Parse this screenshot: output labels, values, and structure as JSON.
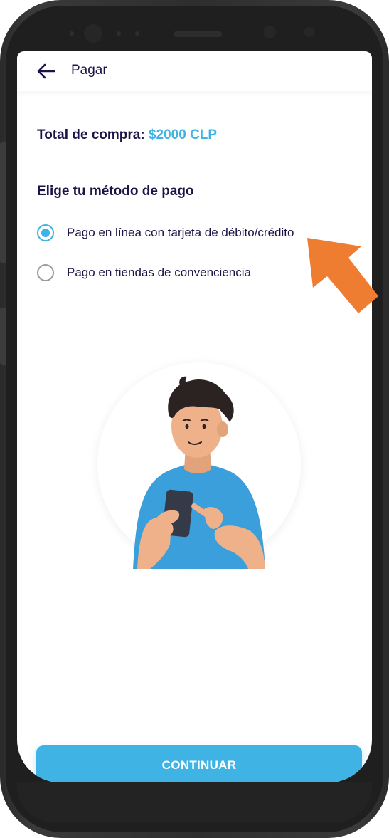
{
  "header": {
    "title": "Pagar"
  },
  "purchase": {
    "label": "Total de compra:",
    "amount": "$2000 CLP"
  },
  "payment": {
    "title": "Elige tu método de pago",
    "options": [
      {
        "label": "Pago en línea con tarjeta de débito/crédito",
        "selected": true
      },
      {
        "label": "Pago en tiendas de convenciencia",
        "selected": false
      }
    ]
  },
  "button": {
    "label": "CONTINUAR"
  },
  "colors": {
    "accent": "#3fb3e3",
    "text": "#1b1446",
    "pointer_arrow": "#ee7d32"
  },
  "icons": {
    "back": "arrow-left-icon",
    "pointer": "orange-arrow-icon"
  }
}
